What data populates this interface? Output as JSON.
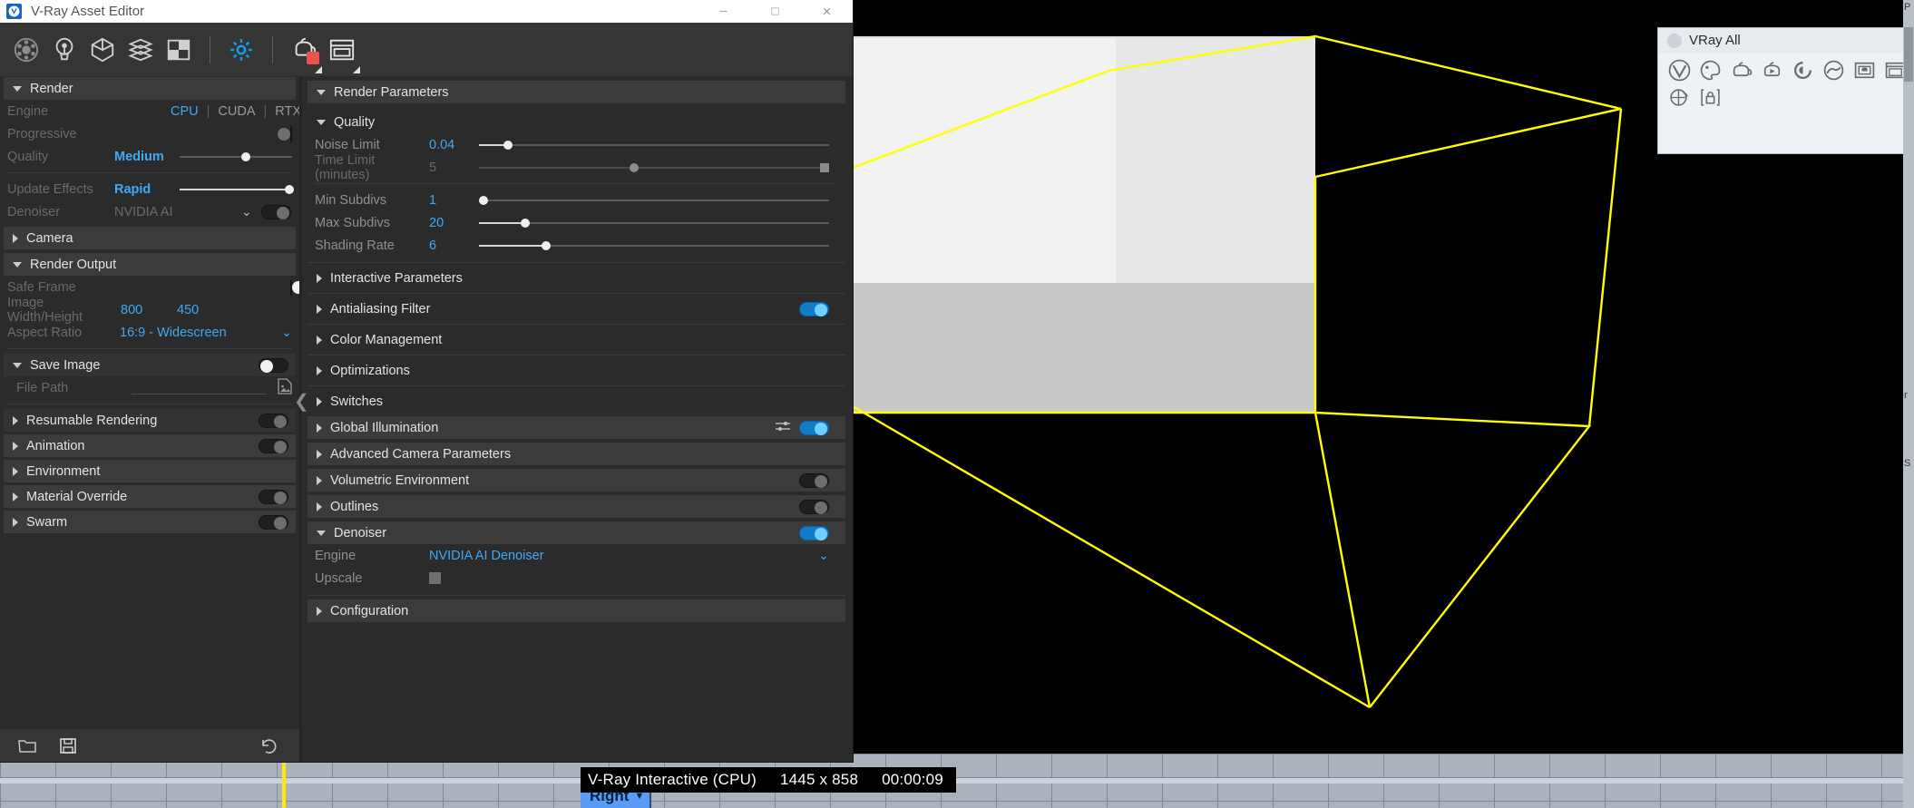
{
  "window": {
    "title": "V-Ray Asset Editor",
    "logo_icon": "vray-logo-icon",
    "minimize_icon": "minimize-icon",
    "maximize_icon": "maximize-icon",
    "close_icon": "close-icon"
  },
  "toolbar": {
    "items": [
      {
        "name": "materials-icon",
        "label": "Materials"
      },
      {
        "name": "lights-icon",
        "label": "Lights"
      },
      {
        "name": "geometry-icon",
        "label": "Geometry"
      },
      {
        "name": "render-elements-icon",
        "label": "Render Elements"
      },
      {
        "name": "textures-icon",
        "label": "Textures"
      },
      {
        "name": "settings-gear-icon",
        "label": "Settings"
      },
      {
        "name": "render-with-vray-icon",
        "label": "Render with V-Ray"
      },
      {
        "name": "frame-buffer-icon",
        "label": "Show V-Ray Frame Buffer"
      }
    ]
  },
  "left_panel": {
    "render_section": {
      "title": "Render",
      "engine": {
        "label": "Engine",
        "options": [
          "CPU",
          "CUDA",
          "RTX"
        ],
        "selected": "CPU",
        "more_icon": "more-vertical-icon"
      },
      "progressive": {
        "label": "Progressive",
        "value": "on"
      },
      "quality": {
        "label": "Quality",
        "value": "Medium",
        "slider_pct": 55
      },
      "update_effects": {
        "label": "Update Effects",
        "value": "Rapid",
        "slider_pct": 100
      },
      "denoiser": {
        "label": "Denoiser",
        "value": "NVIDIA AI",
        "toggle": "on"
      }
    },
    "camera_section": {
      "title": "Camera"
    },
    "render_output_section": {
      "title": "Render Output",
      "safe_frame": {
        "label": "Safe Frame",
        "value": "on"
      },
      "image_size": {
        "label": "Image Width/Height",
        "width": "800",
        "height": "450"
      },
      "aspect_ratio": {
        "label": "Aspect Ratio",
        "value": "16:9 - Widescreen"
      }
    },
    "save_image_section": {
      "title": "Save Image",
      "toggle": "on",
      "file_path": {
        "label": "File Path",
        "value": "",
        "browse_icon": "file-image-icon"
      }
    },
    "collapsible": [
      {
        "title": "Resumable Rendering",
        "toggle": "off"
      },
      {
        "title": "Animation",
        "toggle": "off"
      },
      {
        "title": "Environment",
        "toggle": "off"
      },
      {
        "title": "Material Override",
        "toggle": "off"
      },
      {
        "title": "Swarm",
        "toggle": "off"
      }
    ],
    "footer": {
      "open_icon": "folder-open-icon",
      "save_icon": "floppy-save-icon",
      "revert_icon": "undo-revert-icon"
    },
    "collapse_handle_icon": "chevron-left-icon"
  },
  "middle_panel": {
    "render_parameters": {
      "title": "Render Parameters"
    },
    "quality": {
      "title": "Quality",
      "rows": [
        {
          "label": "Noise Limit",
          "value": "0.04",
          "slider_pct": 9,
          "enabled": true
        },
        {
          "label": "Time Limit (minutes)",
          "value": "5",
          "slider_pct": 43,
          "enabled": false
        },
        {
          "label": "Min Subdivs",
          "value": "1",
          "slider_pct": 3,
          "enabled": true
        },
        {
          "label": "Max Subdivs",
          "value": "20",
          "slider_pct": 14,
          "enabled": true
        },
        {
          "label": "Shading Rate",
          "value": "6",
          "slider_pct": 20,
          "enabled": true
        }
      ]
    },
    "sections": [
      {
        "title": "Interactive Parameters",
        "expanded": false,
        "toggle": null
      },
      {
        "title": "Antialiasing Filter",
        "expanded": false,
        "toggle": "on-blue"
      },
      {
        "title": "Color Management",
        "expanded": false,
        "toggle": null
      },
      {
        "title": "Optimizations",
        "expanded": false,
        "toggle": null
      },
      {
        "title": "Switches",
        "expanded": false,
        "toggle": null
      },
      {
        "title": "Global Illumination",
        "expanded": false,
        "toggle": "on-blue",
        "extra_icon": "sliders-icon"
      },
      {
        "title": "Advanced Camera Parameters",
        "expanded": false,
        "toggle": null
      },
      {
        "title": "Volumetric Environment",
        "expanded": false,
        "toggle": "off"
      },
      {
        "title": "Outlines",
        "expanded": false,
        "toggle": "off"
      }
    ],
    "denoiser": {
      "title": "Denoiser",
      "toggle": "on-blue",
      "engine": {
        "label": "Engine",
        "value": "NVIDIA AI Denoiser",
        "caret_icon": "chevron-down-icon"
      },
      "upscale": {
        "label": "Upscale",
        "checked": false
      }
    },
    "configuration": {
      "title": "Configuration"
    }
  },
  "vray_all_toolbar": {
    "title": "VRay All",
    "dot_icon": "window-dot-icon",
    "buttons": [
      {
        "name": "vray-logo-icon",
        "label": "V-Ray"
      },
      {
        "name": "asset-editor-icon",
        "label": "Asset Editor"
      },
      {
        "name": "render-teapot-icon",
        "label": "Render"
      },
      {
        "name": "render-interactive-icon",
        "label": "Render Interactive"
      },
      {
        "name": "render-last-icon",
        "label": "Render Last"
      },
      {
        "name": "render-cloud-icon",
        "label": "Render in Cloud"
      },
      {
        "name": "frame-buffer-icon",
        "label": "Frame Buffer"
      },
      {
        "name": "batch-render-icon",
        "label": "Batch Render"
      },
      {
        "name": "viewport-render-icon",
        "label": "Viewport Render"
      },
      {
        "name": "lock-icon",
        "label": "Lock"
      }
    ]
  },
  "status_bar": {
    "engine_label": "V-Ray Interactive (CPU)",
    "resolution": "1445 x 858",
    "elapsed": "00:00:09"
  },
  "viewport": {
    "view_label": "Right",
    "view_caret_icon": "chevron-down-icon",
    "wireframe_color": "#ffff00",
    "background_color": "#000000",
    "surface_color": "#dddddd"
  },
  "host_right_strip": {
    "labels": [
      "P",
      "r",
      "S"
    ]
  },
  "colors": {
    "accent_blue": "#3fa9f5",
    "panel_bg": "#2b2b2b",
    "section_bg": "#3b3b3b",
    "toggle_blue": "#117dc9"
  }
}
